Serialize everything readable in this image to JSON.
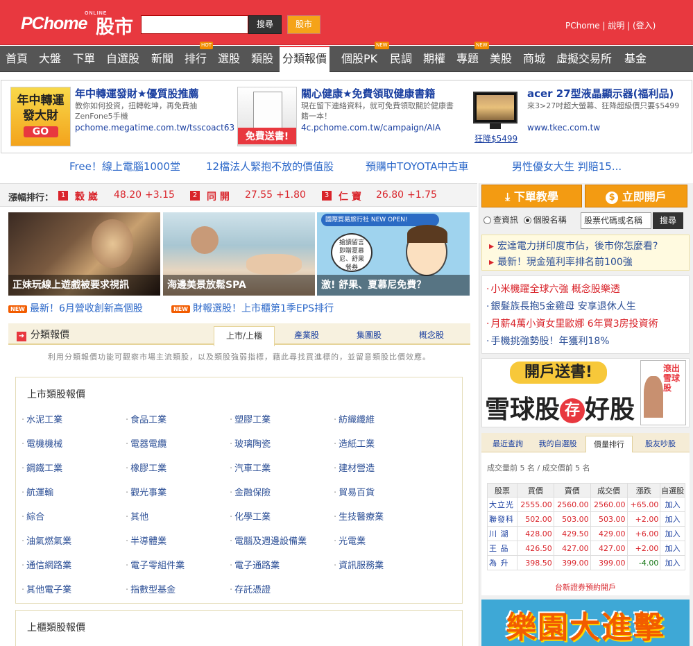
{
  "header": {
    "logo": "PChome",
    "logo_sup": "ONLINE",
    "logo_cn": "股市",
    "search_placeholder": "",
    "search_button": "搜尋",
    "stock_button": "股市",
    "links": [
      "PChome",
      "說明",
      "(登入)"
    ]
  },
  "nav": {
    "items": [
      "首頁",
      "大盤",
      "下單",
      "自選股",
      "新聞",
      "排行",
      "選股",
      "類股",
      "分類報價",
      "個股PK",
      "民調",
      "期權",
      "專題",
      "美股",
      "商城",
      "虛擬交易所",
      "基金"
    ],
    "active": "分類報價",
    "badges": {
      "hot": "HOT",
      "new1": "NEW",
      "new2": "NEW"
    }
  },
  "ads": [
    {
      "img_text": "年中轉運發大財",
      "img_sub": "GO",
      "title": "年中轉運發財★優質股推薦",
      "desc": "教你如何投資，扭轉乾坤，再免費抽ZenFone5手機",
      "url": "pchome.megatime.com.tw/tsscoact63"
    },
    {
      "img_text": "免費送書!",
      "title": "關心健康★免費領取健康書籍",
      "desc": "現在留下連絡資料，就可免費領取關於健康書籍一本！",
      "url": "4c.pchome.com.tw/campaign/AIA"
    },
    {
      "img_caption": "狂降$5499",
      "title": "acer 27型液晶顯示器(福利品)",
      "desc": "來3>27吋超大螢幕、狂降超級價只要$5499",
      "url": "www.tkec.com.tw"
    }
  ],
  "promos": [
    "Free！線上電腦1000堂",
    "12檔法人緊抱不放的價值股",
    "預購中TOYOTA中古車",
    "男性優女大生 判賠15..."
  ],
  "ticker": {
    "label": "漲幅排行：",
    "items": [
      {
        "rank": "1",
        "name": "穀 崴",
        "price": "48.20",
        "chg": "+3.15"
      },
      {
        "rank": "2",
        "name": "同 開",
        "price": "27.55",
        "chg": "+1.80"
      },
      {
        "rank": "3",
        "name": "仁 寶",
        "price": "26.80",
        "chg": "+1.75"
      }
    ]
  },
  "photos": [
    {
      "caption": "正妹玩線上遊戲被要求視訊"
    },
    {
      "caption": "海邊美景放鬆SPA"
    },
    {
      "caption": "激! 舒果、夏慕尼免費？",
      "banner": "國際貿易旅行社 NEW OPEN!",
      "bubble": "搶讀留言即贈夏慕尼、舒果餐券"
    }
  ],
  "new_links": [
    {
      "tag": "NEW",
      "text": "最新！6月營收創新高個股"
    },
    {
      "tag": "NEW",
      "text": "財報選股！上市櫃第1季EPS排行"
    }
  ],
  "category": {
    "title": "分類報價",
    "tabs": [
      "上市/上櫃",
      "產業股",
      "集團股",
      "概念股"
    ],
    "desc": "利用分類報價功能可觀察市場主流類股，以及類股強弱指標，藉此尋找買進標的，並留意類股比價效應。",
    "listed_title": "上市類股報價",
    "industries": [
      "水泥工業",
      "食品工業",
      "塑膠工業",
      "紡織纖維",
      "電機機械",
      "電器電纜",
      "玻璃陶瓷",
      "造紙工業",
      "鋼鐵工業",
      "橡膠工業",
      "汽車工業",
      "建材營造",
      "航運輸",
      "觀光事業",
      "金融保險",
      "貿易百貨",
      "綜合",
      "其他",
      "化學工業",
      "生技醫療業",
      "油氣燃氣業",
      "半導體業",
      "電腦及週邊設備業",
      "光電業",
      "通信網路業",
      "電子零組件業",
      "電子通路業",
      "資訊服務業",
      "其他電子業",
      "指數型基金",
      "存託憑證"
    ],
    "otc_title": "上櫃類股報價"
  },
  "right": {
    "btn1": "下單教學",
    "btn2": "立即開戶",
    "radio1": "查資訊",
    "radio2": "個股名稱",
    "input_placeholder": "股票代碼或名稱",
    "search": "搜尋",
    "news": [
      "宏達電力拼印度市佔，後市你怎麼看?",
      "最新！現金殖利率排名前100強"
    ],
    "links": [
      {
        "text": "小米機躍全球六強 概念股樂透",
        "color": "#d9232a"
      },
      {
        "text": "銀髮族長抱5金雞母 安享退休人生",
        "color": "#2c4f96"
      },
      {
        "text": "月薪4萬小資女里歐娜 6年買3房投資術",
        "color": "#d9232a"
      },
      {
        "text": "手機挑強勢股！年獲利18%",
        "color": "#2c4f96"
      }
    ],
    "banner": {
      "top": "開戶送書!",
      "main1": "雪球股",
      "circle": "存",
      "main2": "好股",
      "book": "滾出雪球股"
    },
    "tabs": [
      "最近查詢",
      "我的自選股",
      "價量排行",
      "股友吵股"
    ],
    "caption": "成交量前 5 名 / 成交價前 5 名",
    "table_head": [
      "股票",
      "買價",
      "賣價",
      "成交價",
      "漲跌",
      "自選股"
    ],
    "table_rows": [
      {
        "name": "大立光",
        "bid": "2555.00",
        "ask": "2560.00",
        "price": "2560.00",
        "chg": "+65.00",
        "add": "加入"
      },
      {
        "name": "聯發科",
        "bid": "502.00",
        "ask": "503.00",
        "price": "503.00",
        "chg": "+2.00",
        "add": "加入"
      },
      {
        "name": "川 湖",
        "bid": "428.00",
        "ask": "429.50",
        "price": "429.00",
        "chg": "+6.00",
        "add": "加入"
      },
      {
        "name": "王 品",
        "bid": "426.50",
        "ask": "427.00",
        "price": "427.00",
        "chg": "+2.00",
        "add": "加入"
      },
      {
        "name": "為 升",
        "bid": "398.50",
        "ask": "399.00",
        "price": "399.00",
        "chg": "-4.00",
        "add": "加入"
      }
    ],
    "note": "台新證券預約開戶",
    "banner2": "樂園大進擊"
  }
}
